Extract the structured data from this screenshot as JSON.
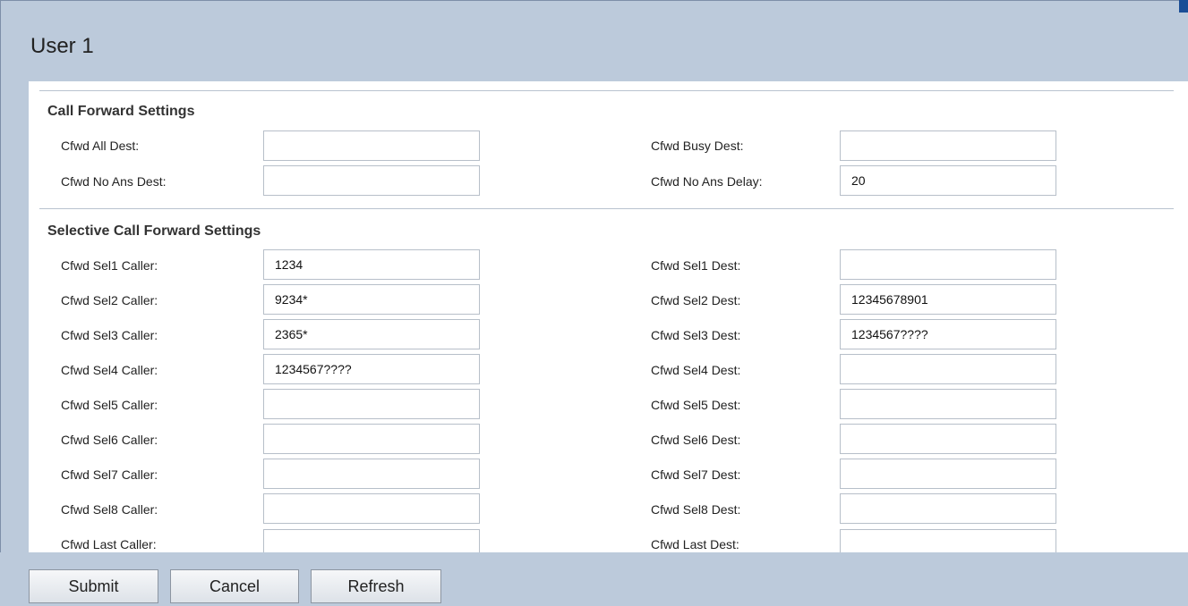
{
  "page_title": "User 1",
  "call_forward": {
    "title": "Call Forward Settings",
    "rows": [
      {
        "left_label": "Cfwd All Dest:",
        "left_value": "",
        "right_label": "Cfwd Busy Dest:",
        "right_value": ""
      },
      {
        "left_label": "Cfwd No Ans Dest:",
        "left_value": "",
        "right_label": "Cfwd No Ans Delay:",
        "right_value": "20"
      }
    ]
  },
  "selective": {
    "title": "Selective Call Forward Settings",
    "rows": [
      {
        "left_label": "Cfwd Sel1 Caller:",
        "left_value": "1234",
        "right_label": "Cfwd Sel1 Dest:",
        "right_value": ""
      },
      {
        "left_label": "Cfwd Sel2 Caller:",
        "left_value": "9234*",
        "right_label": "Cfwd Sel2 Dest:",
        "right_value": "12345678901"
      },
      {
        "left_label": "Cfwd Sel3 Caller:",
        "left_value": "2365*",
        "right_label": "Cfwd Sel3 Dest:",
        "right_value": "1234567????"
      },
      {
        "left_label": "Cfwd Sel4 Caller:",
        "left_value": "1234567????",
        "right_label": "Cfwd Sel4 Dest:",
        "right_value": ""
      },
      {
        "left_label": "Cfwd Sel5 Caller:",
        "left_value": "",
        "right_label": "Cfwd Sel5 Dest:",
        "right_value": ""
      },
      {
        "left_label": "Cfwd Sel6 Caller:",
        "left_value": "",
        "right_label": "Cfwd Sel6 Dest:",
        "right_value": ""
      },
      {
        "left_label": "Cfwd Sel7 Caller:",
        "left_value": "",
        "right_label": "Cfwd Sel7 Dest:",
        "right_value": ""
      },
      {
        "left_label": "Cfwd Sel8 Caller:",
        "left_value": "",
        "right_label": "Cfwd Sel8 Dest:",
        "right_value": ""
      },
      {
        "left_label": "Cfwd Last Caller:",
        "left_value": "",
        "right_label": "Cfwd Last Dest:",
        "right_value": ""
      }
    ]
  },
  "buttons": {
    "submit": "Submit",
    "cancel": "Cancel",
    "refresh": "Refresh"
  },
  "colors": {
    "frame_background": "#bccadb",
    "panel_background": "#ffffff",
    "accent": "#1a4d96"
  }
}
